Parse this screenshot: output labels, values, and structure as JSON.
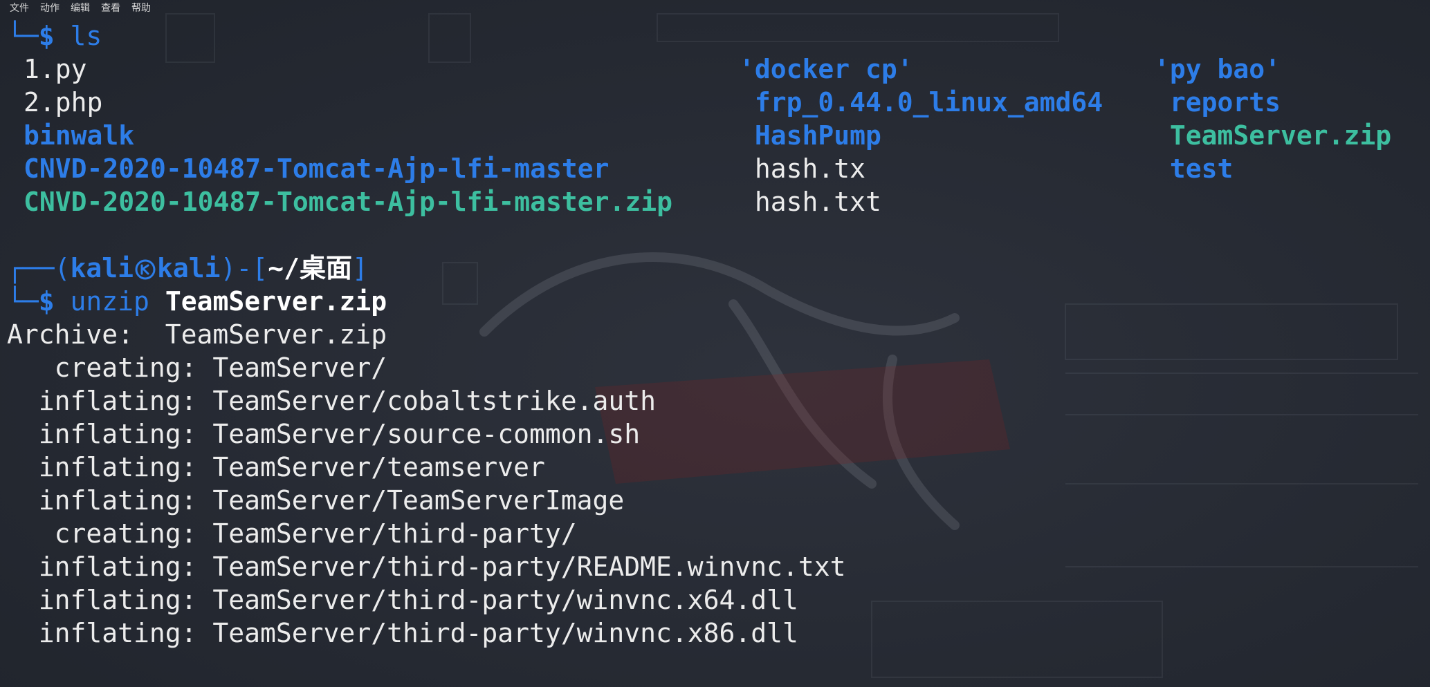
{
  "menu": [
    "文件",
    "动作",
    "编辑",
    "查看",
    "帮助"
  ],
  "prompt_top": {
    "corner": "└─",
    "dollar": "$",
    "command": "ls"
  },
  "ls": {
    "col1": [
      {
        "name": "1.py",
        "style": "plain"
      },
      {
        "name": "2.php",
        "style": "plain"
      },
      {
        "name": "binwalk",
        "style": "blue"
      },
      {
        "name": "CNVD-2020-10487-Tomcat-Ajp-lfi-master",
        "style": "blue"
      },
      {
        "name": "CNVD-2020-10487-Tomcat-Ajp-lfi-master.zip",
        "style": "teal"
      }
    ],
    "col2": [
      {
        "name": "'docker cp'",
        "style": "blue"
      },
      {
        "name": " frp_0.44.0_linux_amd64",
        "style": "blue"
      },
      {
        "name": " HashPump",
        "style": "blue"
      },
      {
        "name": " hash.tx",
        "style": "plain"
      },
      {
        "name": " hash.txt",
        "style": "plain"
      }
    ],
    "col3": [
      {
        "name": "'py bao'",
        "style": "blue"
      },
      {
        "name": " reports",
        "style": "blue"
      },
      {
        "name": " TeamServer.zip",
        "style": "teal"
      },
      {
        "name": " test",
        "style": "blue"
      }
    ]
  },
  "prompt2": {
    "top_frame": "┌──(",
    "user": "kali",
    "host": "kali",
    "mid": ")-[",
    "cwd": "~/桌面",
    "end": "]",
    "bottom_frame": "└─",
    "dollar": "$",
    "command": "unzip",
    "argument": "TeamServer.zip"
  },
  "unzip_output": [
    "Archive:  TeamServer.zip",
    "   creating: TeamServer/",
    "  inflating: TeamServer/cobaltstrike.auth",
    "  inflating: TeamServer/source-common.sh",
    "  inflating: TeamServer/teamserver",
    "  inflating: TeamServer/TeamServerImage",
    "   creating: TeamServer/third-party/",
    "  inflating: TeamServer/third-party/README.winvnc.txt",
    "  inflating: TeamServer/third-party/winvnc.x64.dll",
    "  inflating: TeamServer/third-party/winvnc.x86.dll"
  ],
  "colors": {
    "blue": "#2d7de8",
    "teal": "#3dbfa0",
    "text": "#ececec",
    "background": "#262a33"
  }
}
